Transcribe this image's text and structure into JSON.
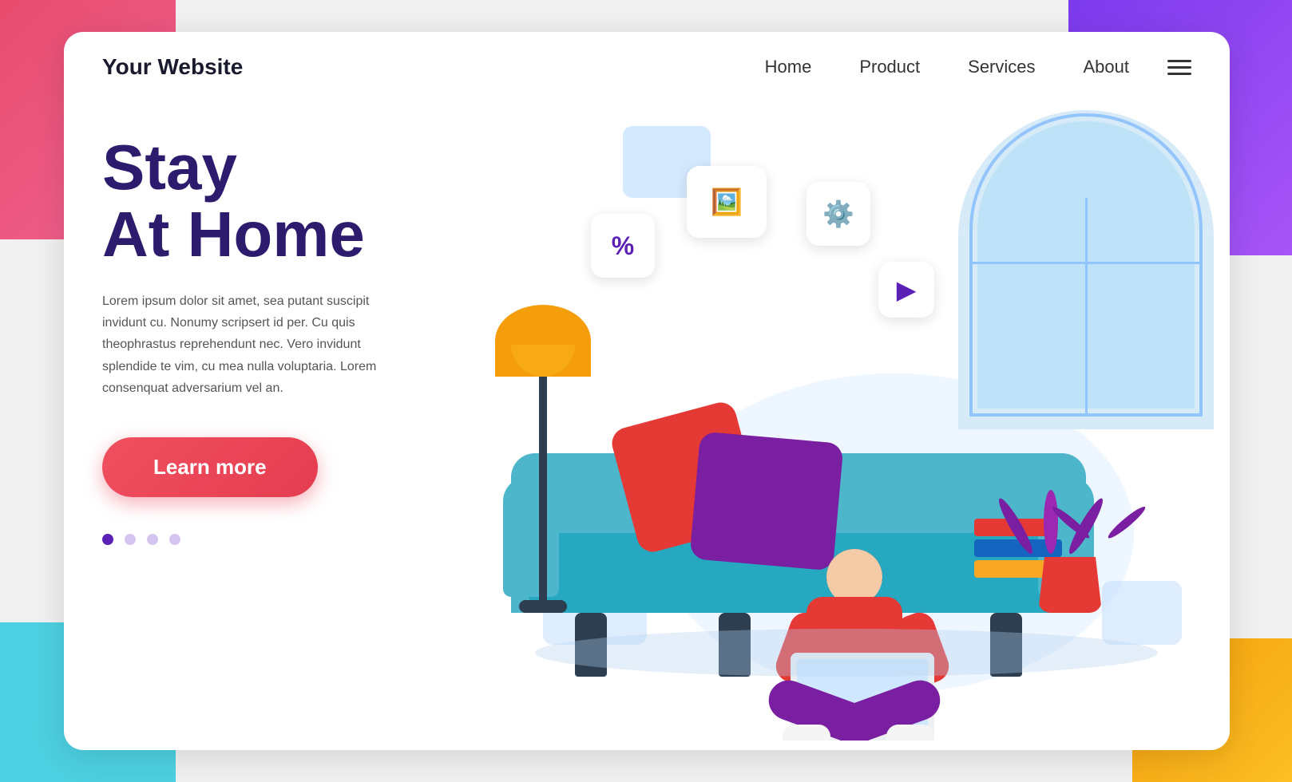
{
  "background": {
    "colors": {
      "tl": "#e84c6e",
      "tr": "#7c3aed",
      "bl": "#4dd0e1",
      "br": "#f59e0b"
    }
  },
  "header": {
    "logo": "Your Website",
    "nav": {
      "home": "Home",
      "product": "Product",
      "services": "Services",
      "about": "About"
    },
    "hamburger_icon": "☰"
  },
  "hero": {
    "title_line1": "Stay",
    "title_line2": "At Home",
    "body": "Lorem ipsum dolor sit amet, sea putant suscipit invidunt cu. Nonumy scripsert id per. Cu quis theophrastus reprehendunt nec. Vero invidunt splendide te vim, cu mea nulla voluptaria. Lorem consenquat adversarium vel an.",
    "cta_button": "Learn more",
    "dots": [
      "active",
      "inactive",
      "inactive",
      "inactive"
    ]
  },
  "bubbles": {
    "photo_icon": "🖼",
    "percent_icon": "%",
    "gear_icon": "⚙",
    "play_icon": "▶"
  }
}
